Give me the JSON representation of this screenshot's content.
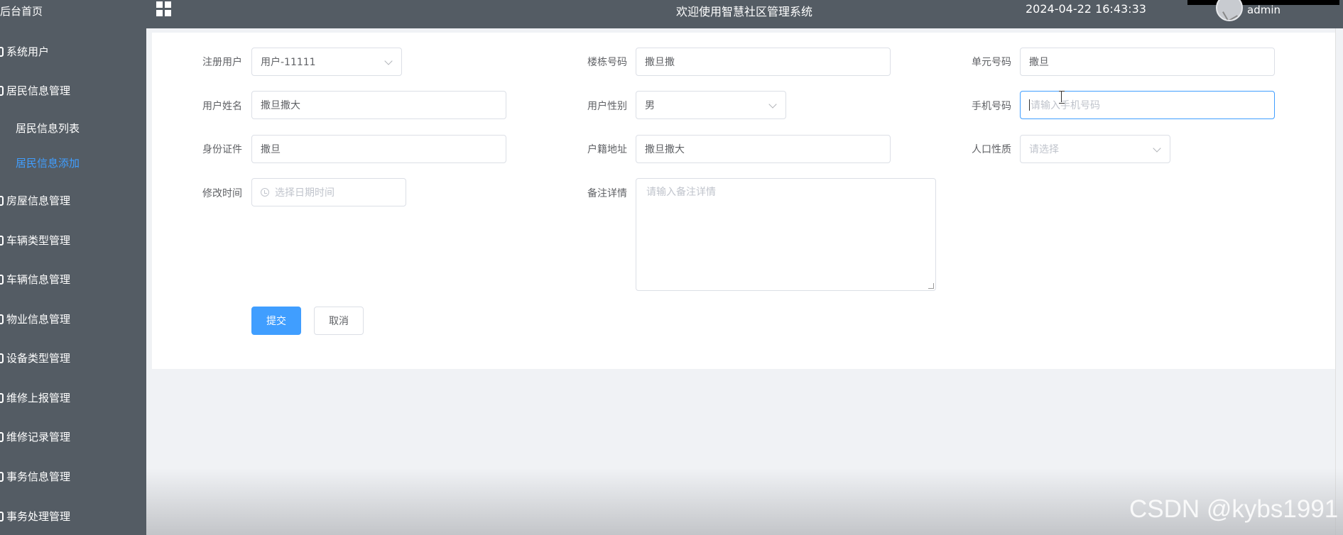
{
  "sidebar": {
    "items": [
      {
        "label": "后台首页",
        "icon": "home-icon"
      },
      {
        "label": "系统用户",
        "icon": "user-icon"
      },
      {
        "label": "居民信息管理",
        "icon": "folder-icon"
      },
      {
        "label": "居民信息列表"
      },
      {
        "label": "居民信息添加",
        "active": true
      },
      {
        "label": "房屋信息管理",
        "icon": "folder-icon"
      },
      {
        "label": "车辆类型管理",
        "icon": "folder-icon"
      },
      {
        "label": "车辆信息管理",
        "icon": "folder-icon"
      },
      {
        "label": "物业信息管理",
        "icon": "folder-icon"
      },
      {
        "label": "设备类型管理",
        "icon": "folder-icon"
      },
      {
        "label": "维修上报管理",
        "icon": "folder-icon"
      },
      {
        "label": "维修记录管理",
        "icon": "folder-icon"
      },
      {
        "label": "事务信息管理",
        "icon": "folder-icon"
      },
      {
        "label": "事务处理管理",
        "icon": "folder-icon"
      }
    ]
  },
  "header": {
    "title": "欢迎使用智慧社区管理系统",
    "datetime": "2024-04-22 16:43:33",
    "username": "admin",
    "menu_icon": "grid-icon"
  },
  "form": {
    "register_user": {
      "label": "注册用户",
      "value": "用户-11111"
    },
    "building_no": {
      "label": "楼栋号码",
      "value": "撒旦撒"
    },
    "unit_no": {
      "label": "单元号码",
      "value": "撒旦"
    },
    "user_name": {
      "label": "用户姓名",
      "value": "撒旦撒大"
    },
    "gender": {
      "label": "用户性别",
      "value": "男"
    },
    "phone": {
      "label": "手机号码",
      "placeholder": "请输入手机号码"
    },
    "id_card": {
      "label": "身份证件",
      "value": "撒旦"
    },
    "household_address": {
      "label": "户籍地址",
      "value": "撒旦撒大"
    },
    "population_type": {
      "label": "人口性质",
      "placeholder": "请选择"
    },
    "modify_time": {
      "label": "修改时间",
      "placeholder": "选择日期时间"
    },
    "remarks": {
      "label": "备注详情",
      "placeholder": "请输入备注详情"
    },
    "submit_label": "提交",
    "cancel_label": "取消"
  },
  "watermark": "CSDN @kybs1991",
  "colors": {
    "sidebar_bg": "#545c64",
    "accent": "#409eff",
    "page_bg": "#f0f2f5"
  }
}
